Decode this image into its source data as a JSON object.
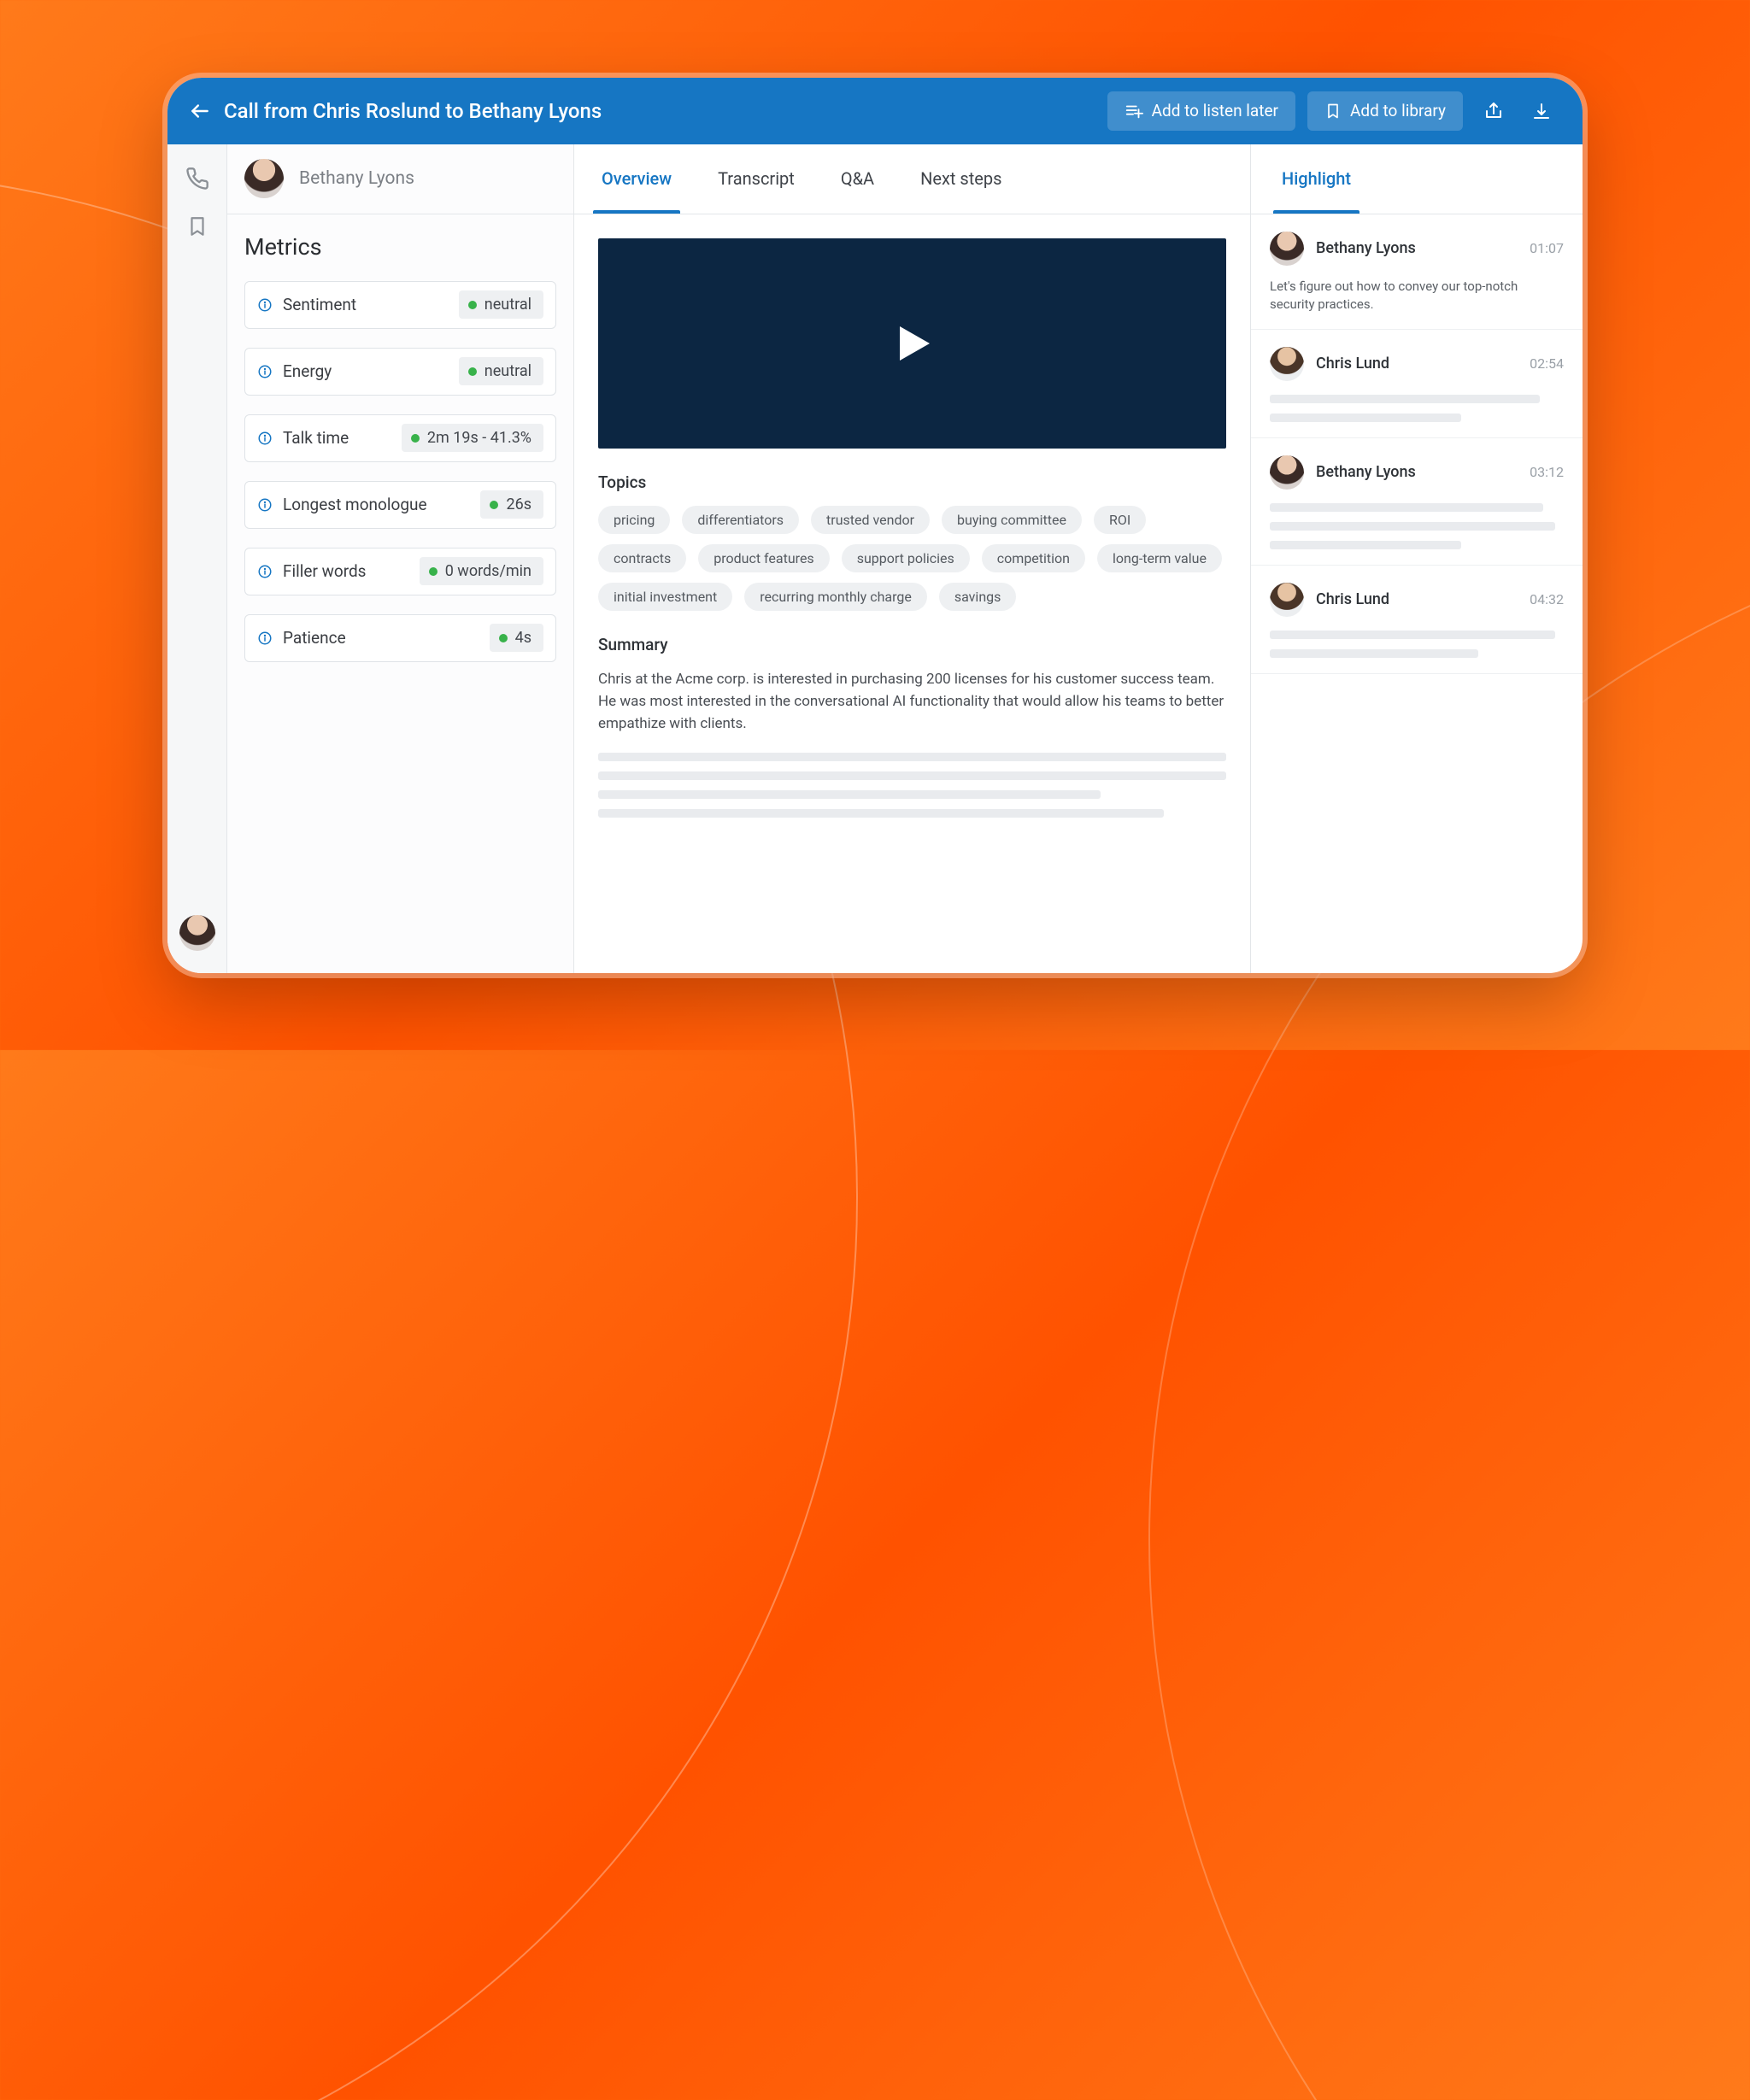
{
  "header": {
    "title": "Call from Chris Roslund to Bethany Lyons",
    "listen_later": "Add to listen later",
    "add_library": "Add to library"
  },
  "left": {
    "person_name": "Bethany Lyons",
    "metrics_title": "Metrics",
    "metrics": [
      {
        "label": "Sentiment",
        "value": "neutral"
      },
      {
        "label": "Energy",
        "value": "neutral"
      },
      {
        "label": "Talk time",
        "value": "2m 19s - 41.3%"
      },
      {
        "label": "Longest monologue",
        "value": "26s"
      },
      {
        "label": "Filler words",
        "value": "0 words/min"
      },
      {
        "label": "Patience",
        "value": "4s"
      }
    ]
  },
  "tabs": {
    "overview": "Overview",
    "transcript": "Transcript",
    "qna": "Q&A",
    "next_steps": "Next steps",
    "highlight": "Highlight"
  },
  "mid": {
    "topics_title": "Topics",
    "topics": [
      "pricing",
      "differentiators",
      "trusted vendor",
      "buying committee",
      "ROI",
      "contracts",
      "product features",
      "support policies",
      "competition",
      "long-term value",
      "initial investment",
      "recurring monthly charge",
      "savings"
    ],
    "summary_title": "Summary",
    "summary_text": "Chris at the Acme corp. is interested in purchasing 200 licenses for his customer success team. He was most interested in the conversational AI functionality that would allow his teams to better empathize with clients."
  },
  "highlights": [
    {
      "name": "Bethany Lyons",
      "time": "01:07",
      "text": "Let's figure out how to convey our top-notch security practices.",
      "gender": "f"
    },
    {
      "name": "Chris Lund",
      "time": "02:54",
      "text": "",
      "gender": "m"
    },
    {
      "name": "Bethany Lyons",
      "time": "03:12",
      "text": "",
      "gender": "f",
      "lines": 3
    },
    {
      "name": "Chris Lund",
      "time": "04:32",
      "text": "",
      "gender": "m"
    }
  ]
}
